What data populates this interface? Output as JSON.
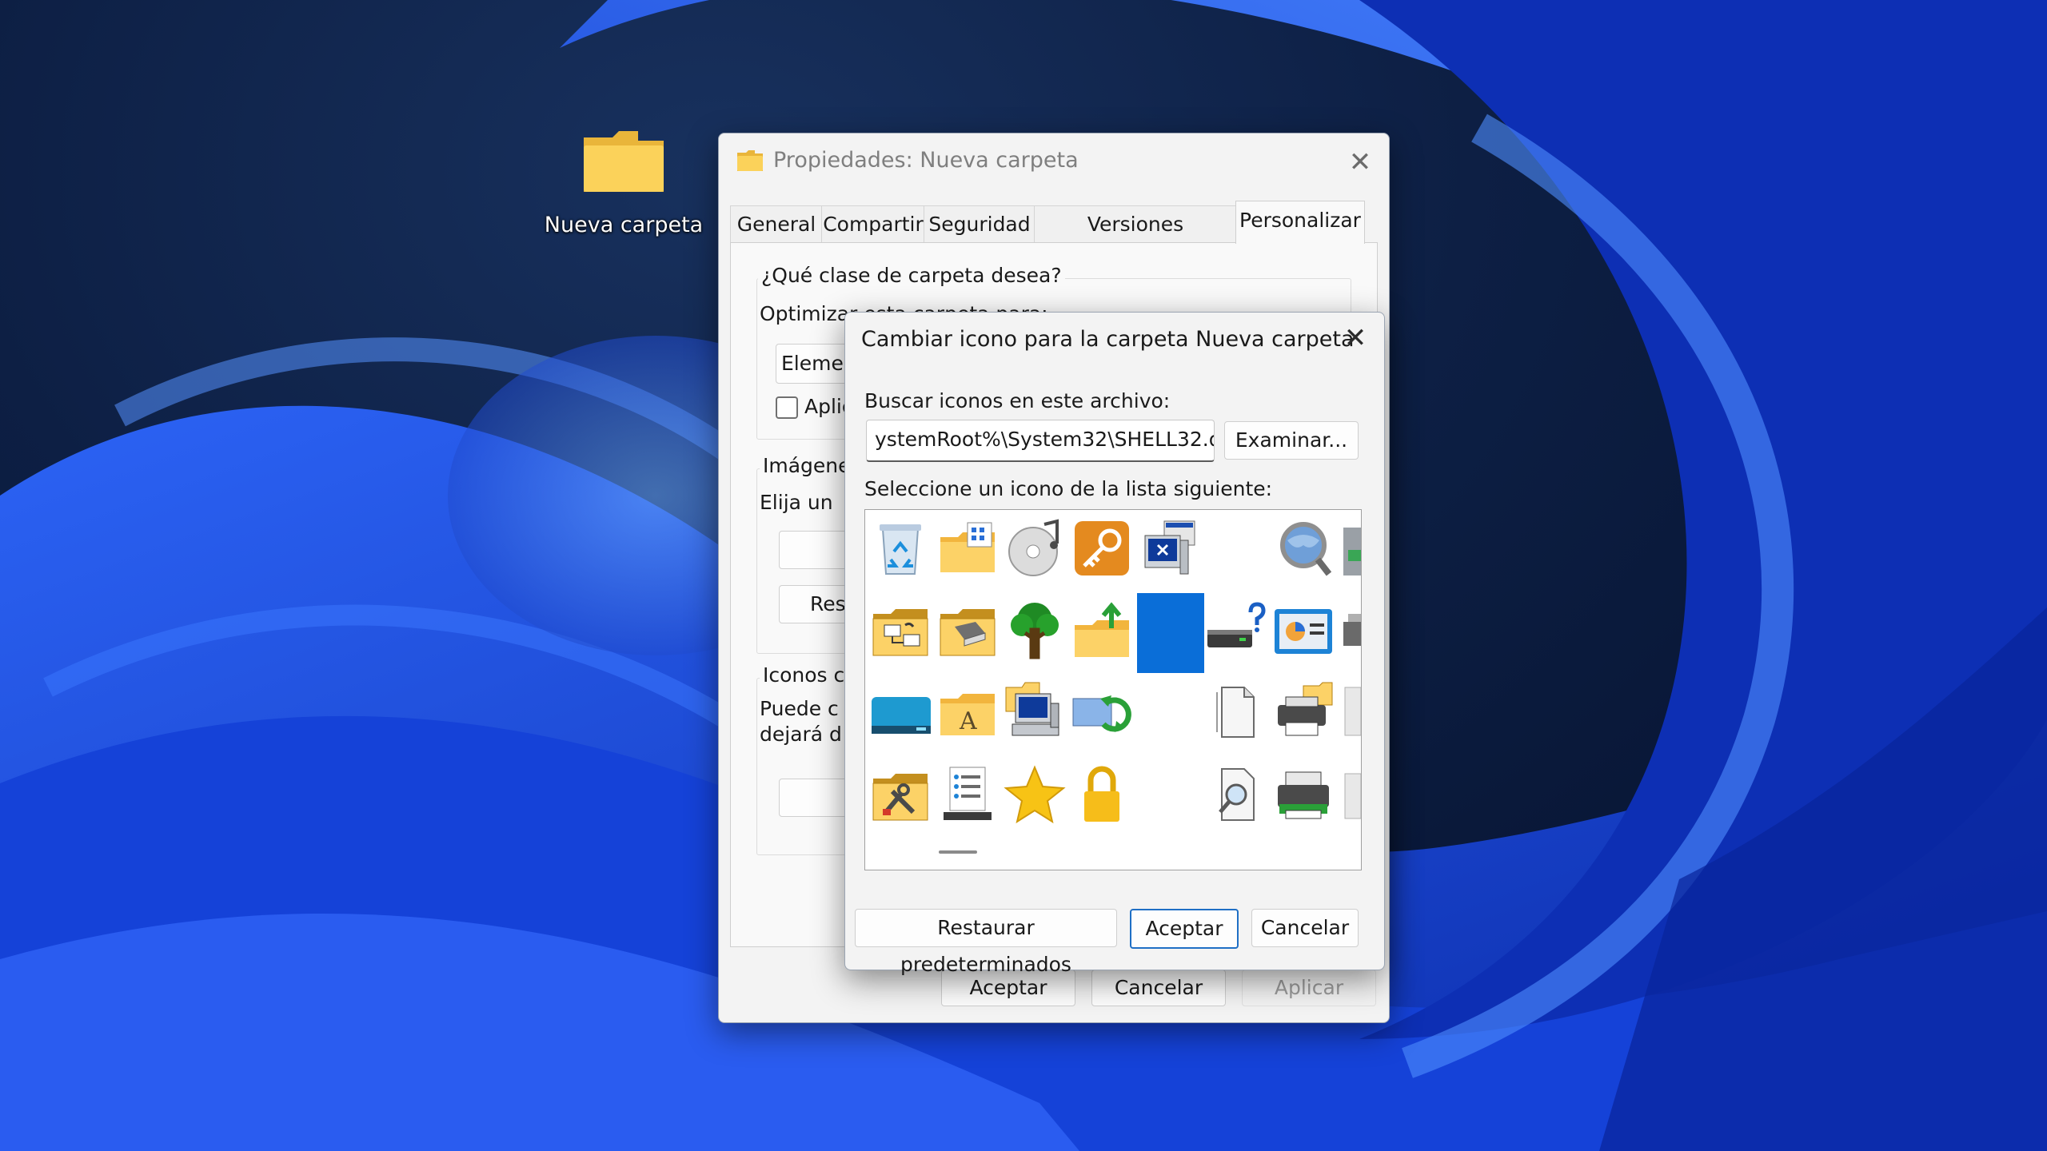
{
  "desktop": {
    "folder_label": "Nueva carpeta",
    "icon": "folder-icon"
  },
  "properties_window": {
    "title": "Propiedades: Nueva carpeta",
    "tabs": [
      {
        "label": "General"
      },
      {
        "label": "Compartir"
      },
      {
        "label": "Seguridad"
      },
      {
        "label": "Versiones anteriores"
      },
      {
        "label": "Personalizar",
        "active": true
      }
    ],
    "folder_type_group": {
      "title": "¿Qué clase de carpeta desea?",
      "optimize_label": "Optimizar esta carpeta para:",
      "dropdown_value": "Elemen",
      "apply_checkbox_label": "Aplic"
    },
    "images_group": {
      "title": "Imágene",
      "choose_label": "Elija un",
      "restore_button": "Res"
    },
    "icons_group": {
      "title": "Iconos c",
      "desc_line1": "Puede c",
      "desc_line2": "dejará d"
    },
    "buttons": {
      "ok": "Aceptar",
      "cancel": "Cancelar",
      "apply": "Aplicar"
    }
  },
  "change_icon_dialog": {
    "title": "Cambiar icono para la carpeta Nueva carpeta",
    "search_label": "Buscar iconos en este archivo:",
    "file_path": "ystemRoot%\\System32\\SHELL32.dll",
    "browse_button": "Examinar...",
    "select_label": "Seleccione un icono de la lista siguiente:",
    "icons": [
      "recycle-bin-icon",
      "folder-grid-icon",
      "cd-icon",
      "key-icon",
      "computer-window-icon",
      "blank-icon",
      "magnifier-globe-icon",
      "partial-icon",
      "folder-network-icon",
      "folder-printer-icon",
      "tree-icon",
      "folder-upload-icon",
      "selected-blue-icon",
      "drive-question-icon",
      "control-panel-icon",
      "partial-icon",
      "drive-teal-icon",
      "folder-font-icon",
      "computer-folder-icon",
      "sync-icon",
      "blank-icon",
      "document-icon",
      "printer-folder-icon",
      "partial-icon",
      "folder-tools-icon",
      "list-server-icon",
      "star-icon",
      "lock-icon",
      "blank-icon",
      "document-search-icon",
      "printer-green-icon",
      "partial-icon"
    ],
    "selected_index": 12,
    "buttons": {
      "restore": "Restaurar predeterminados",
      "ok": "Aceptar",
      "cancel": "Cancelar"
    }
  },
  "colors": {
    "accent": "#1f6fc5",
    "folder_yellow": "#f8c94a",
    "wallpaper_blue": "#1f4fe0"
  }
}
